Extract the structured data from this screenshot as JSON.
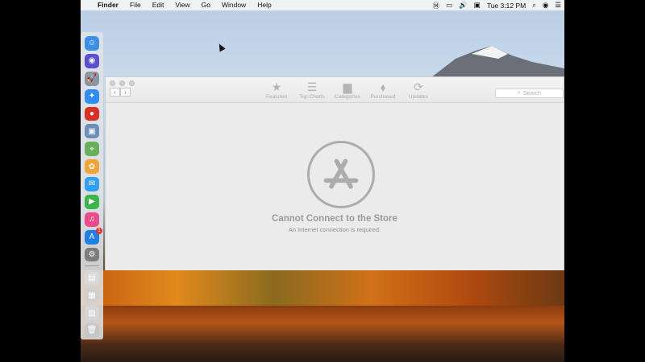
{
  "menubar": {
    "app_name": "Finder",
    "items": [
      "File",
      "Edit",
      "View",
      "Go",
      "Window",
      "Help"
    ],
    "clock": "Tue 3:12 PM"
  },
  "dock": {
    "apps": [
      {
        "name": "finder-icon",
        "color": "#3b8fe6",
        "glyph": "☺"
      },
      {
        "name": "siri-icon",
        "color": "#5a4fcf",
        "glyph": "◉"
      },
      {
        "name": "launchpad-icon",
        "color": "#8c95a3",
        "glyph": "🚀"
      },
      {
        "name": "safari-icon",
        "color": "#2f8ef0",
        "glyph": "✦"
      },
      {
        "name": "chrome-icon",
        "color": "#d93025",
        "glyph": "●"
      },
      {
        "name": "preview-icon",
        "color": "#6b8fb9",
        "glyph": "▣"
      },
      {
        "name": "maps-icon",
        "color": "#69b05a",
        "glyph": "⌖"
      },
      {
        "name": "photos-icon",
        "color": "#f2a33a",
        "glyph": "✿"
      },
      {
        "name": "messages-icon",
        "color": "#31a0f0",
        "glyph": "✉"
      },
      {
        "name": "facetime-icon",
        "color": "#3cb44b",
        "glyph": "▶"
      },
      {
        "name": "itunes-icon",
        "color": "#e84c8a",
        "glyph": "♫"
      },
      {
        "name": "app-store-icon",
        "color": "#1f7fe5",
        "glyph": "A",
        "badge": "1"
      },
      {
        "name": "system-preferences-icon",
        "color": "#7d7d7d",
        "glyph": "⚙"
      }
    ],
    "stacks": [
      {
        "name": "document-stack-icon",
        "color": "#d9d9d9",
        "glyph": "▤"
      },
      {
        "name": "downloads-stack-icon",
        "color": "#cfcfcf",
        "glyph": "▦"
      },
      {
        "name": "screenshot-stack-icon",
        "color": "#d6d6d6",
        "glyph": "▧"
      },
      {
        "name": "trash-icon",
        "color": "#c6c6c6",
        "glyph": "🗑"
      }
    ]
  },
  "window": {
    "toolbar": [
      {
        "label": "Featured",
        "glyph": "★"
      },
      {
        "label": "Top Charts",
        "glyph": "☰"
      },
      {
        "label": "Categories",
        "glyph": "▆"
      },
      {
        "label": "Purchased",
        "glyph": "⬧"
      },
      {
        "label": "Updates",
        "glyph": "⟳"
      }
    ],
    "search_placeholder": "Search",
    "error_title": "Cannot Connect to the Store",
    "error_subtitle": "An Internet connection is required."
  }
}
